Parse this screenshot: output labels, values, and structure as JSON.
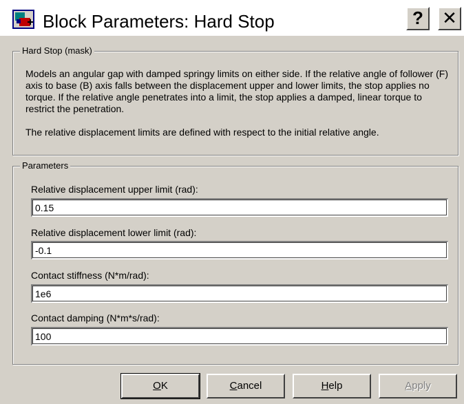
{
  "window": {
    "title": "Block Parameters: Hard Stop",
    "help_glyph": "?",
    "close_glyph": "✕"
  },
  "mask_group": {
    "title": "Hard Stop (mask)",
    "description": "Models an angular gap with damped springy limits on either side. If the relative angle of follower (F) axis to base (B) axis falls between the displacement upper and lower limits, the stop applies no torque. If the relative angle penetrates into a limit, the stop applies a damped, linear torque to restrict the penetration.",
    "note": "The relative displacement limits are defined with respect to the initial relative angle."
  },
  "parameters_group": {
    "title": "Parameters",
    "fields": [
      {
        "label": "Relative displacement upper limit (rad):",
        "value": "0.15"
      },
      {
        "label": "Relative displacement lower limit (rad):",
        "value": "-0.1"
      },
      {
        "label": "Contact stiffness (N*m/rad):",
        "value": "1e6"
      },
      {
        "label": "Contact damping (N*m*s/rad):",
        "value": "100"
      }
    ]
  },
  "buttons": {
    "ok": {
      "mnemonic": "O",
      "rest": "K"
    },
    "cancel": {
      "mnemonic": "C",
      "rest": "ancel"
    },
    "help": {
      "mnemonic": "H",
      "rest": "elp"
    },
    "apply": {
      "mnemonic": "A",
      "rest": "pply",
      "enabled": false
    }
  },
  "icons": {
    "app": "simulink-block-icon",
    "help": "help-question-icon",
    "close": "close-icon"
  }
}
